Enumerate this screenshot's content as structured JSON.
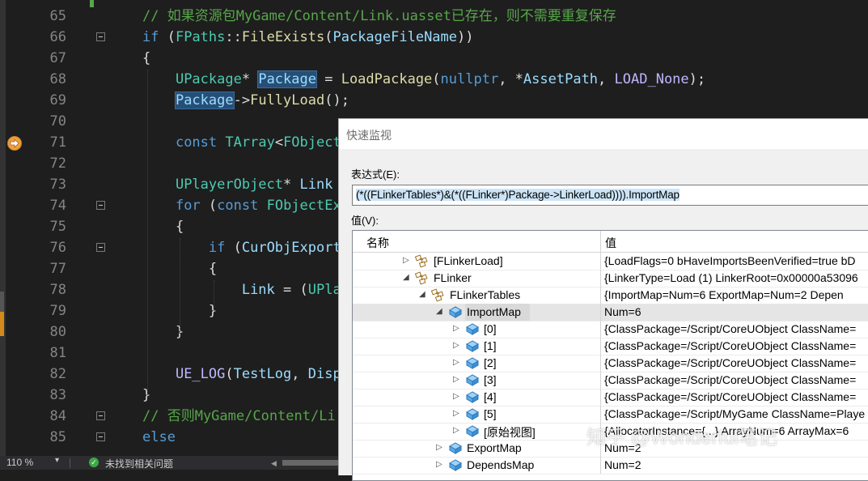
{
  "editor": {
    "lines": [
      {
        "num": "65",
        "tokens": [
          {
            "t": "// 如果资源包MyGame/Content/Link.uasset已存在，则不需要重复保存",
            "c": "cm"
          }
        ]
      },
      {
        "num": "66",
        "tokens": [
          {
            "t": "if",
            "c": "kw"
          },
          {
            "t": " (",
            "c": ""
          },
          {
            "t": "FPaths",
            "c": "ty"
          },
          {
            "t": "::",
            "c": ""
          },
          {
            "t": "FileExists",
            "c": "fn"
          },
          {
            "t": "(",
            "c": ""
          },
          {
            "t": "PackageFileName",
            "c": "var"
          },
          {
            "t": "))",
            "c": ""
          }
        ]
      },
      {
        "num": "67",
        "tokens": [
          {
            "t": "{",
            "c": ""
          }
        ]
      },
      {
        "num": "68",
        "tokens": [
          {
            "t": "    ",
            "c": ""
          },
          {
            "t": "UPackage",
            "c": "ty"
          },
          {
            "t": "* ",
            "c": ""
          },
          {
            "t": "Package",
            "c": "var hl"
          },
          {
            "t": " = ",
            "c": ""
          },
          {
            "t": "LoadPackage",
            "c": "fn"
          },
          {
            "t": "(",
            "c": ""
          },
          {
            "t": "nullptr",
            "c": "kw"
          },
          {
            "t": ", *",
            "c": ""
          },
          {
            "t": "AssetPath",
            "c": "var"
          },
          {
            "t": ", ",
            "c": ""
          },
          {
            "t": "LOAD_None",
            "c": "mac"
          },
          {
            "t": ");",
            "c": ""
          }
        ]
      },
      {
        "num": "69",
        "tokens": [
          {
            "t": "    ",
            "c": ""
          },
          {
            "t": "Package",
            "c": "var hl"
          },
          {
            "t": "->",
            "c": ""
          },
          {
            "t": "FullyLoad",
            "c": "fn"
          },
          {
            "t": "();",
            "c": ""
          }
        ]
      },
      {
        "num": "70",
        "tokens": []
      },
      {
        "num": "71",
        "tokens": [
          {
            "t": "    ",
            "c": ""
          },
          {
            "t": "const",
            "c": "kw"
          },
          {
            "t": " ",
            "c": ""
          },
          {
            "t": "TArray",
            "c": "ty"
          },
          {
            "t": "<",
            "c": ""
          },
          {
            "t": "FObject",
            "c": "ty"
          }
        ]
      },
      {
        "num": "72",
        "tokens": []
      },
      {
        "num": "73",
        "tokens": [
          {
            "t": "    ",
            "c": ""
          },
          {
            "t": "UPlayerObject",
            "c": "ty"
          },
          {
            "t": "* ",
            "c": ""
          },
          {
            "t": "Link",
            "c": "var"
          }
        ]
      },
      {
        "num": "74",
        "tokens": [
          {
            "t": "    ",
            "c": ""
          },
          {
            "t": "for",
            "c": "kw"
          },
          {
            "t": " (",
            "c": ""
          },
          {
            "t": "const",
            "c": "kw"
          },
          {
            "t": " ",
            "c": ""
          },
          {
            "t": "FObjectEx",
            "c": "ty"
          }
        ]
      },
      {
        "num": "75",
        "tokens": [
          {
            "t": "    {",
            "c": ""
          }
        ]
      },
      {
        "num": "76",
        "tokens": [
          {
            "t": "        ",
            "c": ""
          },
          {
            "t": "if",
            "c": "kw"
          },
          {
            "t": " (",
            "c": ""
          },
          {
            "t": "CurObjExport",
            "c": "var"
          }
        ]
      },
      {
        "num": "77",
        "tokens": [
          {
            "t": "        {",
            "c": ""
          }
        ]
      },
      {
        "num": "78",
        "tokens": [
          {
            "t": "            ",
            "c": ""
          },
          {
            "t": "Link",
            "c": "var"
          },
          {
            "t": " = (",
            "c": ""
          },
          {
            "t": "UPla",
            "c": "ty"
          }
        ]
      },
      {
        "num": "79",
        "tokens": [
          {
            "t": "        }",
            "c": ""
          }
        ]
      },
      {
        "num": "80",
        "tokens": [
          {
            "t": "    }",
            "c": ""
          }
        ]
      },
      {
        "num": "81",
        "tokens": []
      },
      {
        "num": "82",
        "tokens": [
          {
            "t": "    ",
            "c": ""
          },
          {
            "t": "UE_LOG",
            "c": "mac"
          },
          {
            "t": "(",
            "c": ""
          },
          {
            "t": "TestLog",
            "c": "var"
          },
          {
            "t": ", ",
            "c": ""
          },
          {
            "t": "Disp",
            "c": "var"
          }
        ]
      },
      {
        "num": "83",
        "tokens": [
          {
            "t": "}",
            "c": ""
          }
        ]
      },
      {
        "num": "84",
        "tokens": [
          {
            "t": "// 否则MyGame/Content/Li",
            "c": "cm"
          }
        ]
      },
      {
        "num": "85",
        "tokens": [
          {
            "t": "else",
            "c": "kw"
          }
        ]
      }
    ]
  },
  "statusbar": {
    "zoom": "110 %",
    "zoom_arrow": "▾",
    "issues": "未找到相关问题",
    "ok_icon": "check-circle-icon"
  },
  "dialog": {
    "title": "快速监视",
    "expression_label": "表达式(E):",
    "expression": "(*((FLinkerTables*)&(*((FLinker*)Package->LinkerLoad)))).ImportMap",
    "value_label": "值(V):",
    "col_name": "名称",
    "col_value": "值",
    "rows": [
      {
        "name": "[FLinkerLoad]",
        "value": "{LoadFlags=0 bHaveImportsBeenVerified=true bD",
        "icon": "class",
        "indent": 1,
        "arrow": "right"
      },
      {
        "name": "FLinker",
        "value": "{LinkerType=Load (1) LinkerRoot=0x00000a53096",
        "icon": "class",
        "indent": 1,
        "arrow": "down"
      },
      {
        "name": "FLinkerTables",
        "value": "{ImportMap=Num=6 ExportMap=Num=2 Depen",
        "icon": "class",
        "indent": 2,
        "arrow": "down"
      },
      {
        "name": "ImportMap",
        "value": "Num=6",
        "icon": "field",
        "indent": 3,
        "arrow": "down",
        "selected": true
      },
      {
        "name": "[0]",
        "value": "{ClassPackage=/Script/CoreUObject ClassName=",
        "icon": "field",
        "indent": 4,
        "arrow": "right"
      },
      {
        "name": "[1]",
        "value": "{ClassPackage=/Script/CoreUObject ClassName=",
        "icon": "field",
        "indent": 4,
        "arrow": "right"
      },
      {
        "name": "[2]",
        "value": "{ClassPackage=/Script/CoreUObject ClassName=",
        "icon": "field",
        "indent": 4,
        "arrow": "right"
      },
      {
        "name": "[3]",
        "value": "{ClassPackage=/Script/CoreUObject ClassName=",
        "icon": "field",
        "indent": 4,
        "arrow": "right"
      },
      {
        "name": "[4]",
        "value": "{ClassPackage=/Script/CoreUObject ClassName=",
        "icon": "field",
        "indent": 4,
        "arrow": "right"
      },
      {
        "name": "[5]",
        "value": "{ClassPackage=/Script/MyGame ClassName=Playe",
        "icon": "field",
        "indent": 4,
        "arrow": "right"
      },
      {
        "name": "[原始视图]",
        "value": "{AllocatorInstance={...} ArrayNum=6 ArrayMax=6",
        "icon": "field",
        "indent": 4,
        "arrow": "right"
      },
      {
        "name": "ExportMap",
        "value": "Num=2",
        "icon": "field",
        "indent": 3,
        "arrow": "right"
      },
      {
        "name": "DependsMap",
        "value": "Num=2",
        "icon": "field",
        "indent": 3,
        "arrow": "right"
      }
    ]
  },
  "watermark": "知乎 @Wonderful笔记"
}
